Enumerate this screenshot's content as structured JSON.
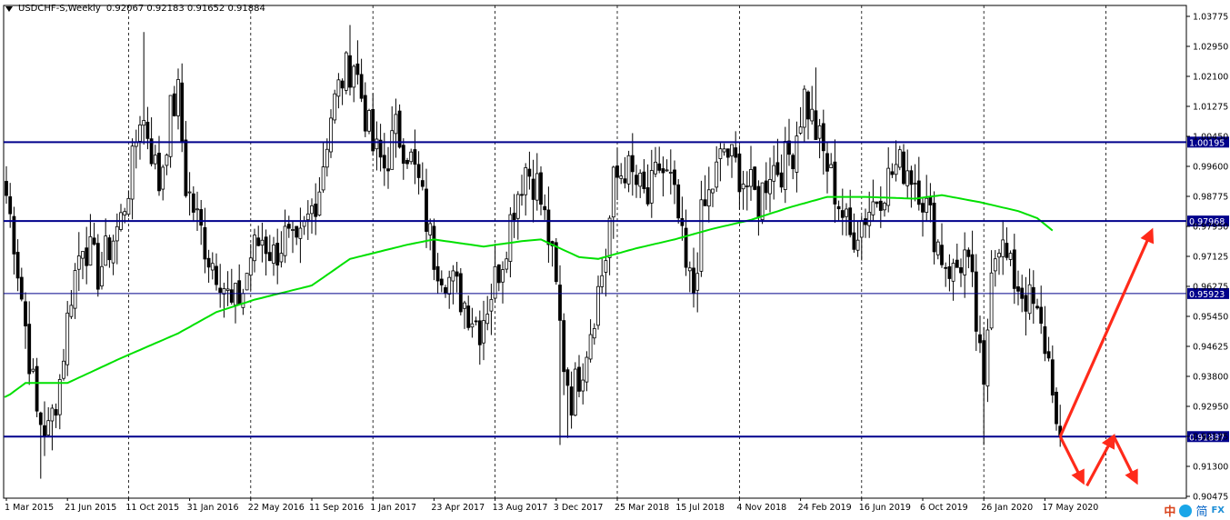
{
  "header": {
    "symbol": "USDCHF-S,Weekly",
    "ohlc": "0.92067 0.92183 0.91652 0.91884"
  },
  "brand": {
    "char1": "中",
    "char2": "简",
    "logo_text": "FX"
  },
  "colors": {
    "candle": "#000000",
    "ma": "#00e000",
    "level": "#00008b",
    "arrow": "#ff2a1a",
    "grid": "#000000",
    "axis_text": "#000000"
  },
  "chart_data": {
    "type": "candlestick",
    "timeframe": "Weekly",
    "ylim": [
      0.9015,
      1.0405
    ],
    "y_ticks": [
      "1.03775",
      "1.02950",
      "1.02100",
      "1.01275",
      "1.00450",
      "0.99600",
      "0.98775",
      "0.97950",
      "0.97125",
      "0.96275",
      "0.95450",
      "0.94625",
      "0.93800",
      "0.92950",
      "0.92125",
      "0.91300",
      "0.90475"
    ],
    "x_ticks": [
      "1 Mar 2015",
      "21 Jun 2015",
      "11 Oct 2015",
      "31 Jan 2016",
      "22 May 2016",
      "11 Sep 2016",
      "1 Jan 2017",
      "23 Apr 2017",
      "13 Aug 2017",
      "3 Dec 2017",
      "25 Mar 2018",
      "15 Jul 2018",
      "4 Nov 2018",
      "24 Feb 2019",
      "16 Jun 2019",
      "6 Oct 2019",
      "26 Jan 2020",
      "17 May 2020"
    ],
    "x_ticks_weeks": [
      0,
      16,
      32,
      48,
      64,
      80,
      96,
      112,
      128,
      144,
      160,
      176,
      192,
      208,
      224,
      240,
      256,
      272
    ],
    "grid_weeks": [
      32,
      64,
      96,
      128,
      160,
      192,
      224,
      256,
      288
    ],
    "total_weeks": 297,
    "price_levels": [
      {
        "label": "1.00195",
        "value": 1.00195,
        "weight": "thick"
      },
      {
        "label": "0.97968",
        "value": 0.97968,
        "weight": "thick"
      },
      {
        "label": "0.95923",
        "value": 0.95923,
        "weight": "thin"
      },
      {
        "label": "0.91887",
        "value": 0.91887,
        "weight": "thick"
      }
    ],
    "close_anchors": [
      [
        0,
        0.987
      ],
      [
        2,
        0.975
      ],
      [
        5,
        0.95
      ],
      [
        8,
        0.925
      ],
      [
        11,
        0.92
      ],
      [
        14,
        0.935
      ],
      [
        17,
        0.96
      ],
      [
        20,
        0.975
      ],
      [
        24,
        0.965
      ],
      [
        28,
        0.975
      ],
      [
        30,
        0.98
      ],
      [
        33,
        0.995
      ],
      [
        35,
        1.01
      ],
      [
        37,
        1.005
      ],
      [
        40,
        0.99
      ],
      [
        43,
        1.01
      ],
      [
        45,
        1.015
      ],
      [
        47,
        0.99
      ],
      [
        50,
        0.98
      ],
      [
        53,
        0.97
      ],
      [
        56,
        0.965
      ],
      [
        59,
        0.955
      ],
      [
        62,
        0.96
      ],
      [
        64,
        0.97
      ],
      [
        67,
        0.975
      ],
      [
        70,
        0.97
      ],
      [
        73,
        0.975
      ],
      [
        76,
        0.97
      ],
      [
        79,
        0.98
      ],
      [
        82,
        0.99
      ],
      [
        85,
        1.01
      ],
      [
        88,
        1.02
      ],
      [
        91,
        1.025
      ],
      [
        93,
        1.015
      ],
      [
        96,
        1.0
      ],
      [
        99,
        0.995
      ],
      [
        102,
        1.005
      ],
      [
        105,
        1.0
      ],
      [
        108,
        0.99
      ],
      [
        110,
        0.98
      ],
      [
        112,
        0.97
      ],
      [
        115,
        0.965
      ],
      [
        118,
        0.96
      ],
      [
        121,
        0.955
      ],
      [
        124,
        0.95
      ],
      [
        127,
        0.96
      ],
      [
        130,
        0.97
      ],
      [
        133,
        0.985
      ],
      [
        136,
        0.995
      ],
      [
        139,
        0.99
      ],
      [
        142,
        0.975
      ],
      [
        144,
        0.96
      ],
      [
        146,
        0.94
      ],
      [
        148,
        0.93
      ],
      [
        151,
        0.94
      ],
      [
        154,
        0.955
      ],
      [
        157,
        0.97
      ],
      [
        159,
        0.99
      ],
      [
        162,
        0.995
      ],
      [
        165,
        0.99
      ],
      [
        168,
        0.985
      ],
      [
        171,
        0.995
      ],
      [
        174,
        0.99
      ],
      [
        176,
        0.98
      ],
      [
        178,
        0.965
      ],
      [
        180,
        0.96
      ],
      [
        182,
        0.98
      ],
      [
        185,
        0.99
      ],
      [
        188,
        1.0
      ],
      [
        191,
        0.995
      ],
      [
        194,
        0.99
      ],
      [
        197,
        0.985
      ],
      [
        200,
        0.995
      ],
      [
        203,
        0.995
      ],
      [
        206,
        1.0
      ],
      [
        209,
        1.015
      ],
      [
        212,
        1.005
      ],
      [
        215,
        0.995
      ],
      [
        218,
        0.985
      ],
      [
        221,
        0.975
      ],
      [
        224,
        0.98
      ],
      [
        227,
        0.985
      ],
      [
        230,
        0.99
      ],
      [
        233,
        0.995
      ],
      [
        236,
        0.995
      ],
      [
        239,
        0.99
      ],
      [
        242,
        0.98
      ],
      [
        245,
        0.97
      ],
      [
        248,
        0.965
      ],
      [
        251,
        0.97
      ],
      [
        253,
        0.96
      ],
      [
        255,
        0.94
      ],
      [
        256,
        0.93
      ],
      [
        258,
        0.97
      ],
      [
        260,
        0.975
      ],
      [
        263,
        0.965
      ],
      [
        266,
        0.96
      ],
      [
        269,
        0.955
      ],
      [
        272,
        0.945
      ],
      [
        274,
        0.935
      ],
      [
        275,
        0.92
      ],
      [
        276,
        0.91884
      ]
    ],
    "ma_anchors": [
      [
        0,
        0.93
      ],
      [
        5,
        0.934
      ],
      [
        16,
        0.934
      ],
      [
        30,
        0.941
      ],
      [
        45,
        0.948
      ],
      [
        55,
        0.954
      ],
      [
        65,
        0.9575
      ],
      [
        80,
        0.9615
      ],
      [
        90,
        0.969
      ],
      [
        105,
        0.973
      ],
      [
        112,
        0.9745
      ],
      [
        125,
        0.9725
      ],
      [
        135,
        0.974
      ],
      [
        140,
        0.9745
      ],
      [
        150,
        0.9695
      ],
      [
        155,
        0.969
      ],
      [
        165,
        0.972
      ],
      [
        175,
        0.9745
      ],
      [
        185,
        0.9775
      ],
      [
        195,
        0.98
      ],
      [
        205,
        0.9835
      ],
      [
        215,
        0.9865
      ],
      [
        225,
        0.9865
      ],
      [
        238,
        0.986
      ],
      [
        245,
        0.987
      ],
      [
        255,
        0.985
      ],
      [
        265,
        0.9825
      ],
      [
        270,
        0.9805
      ],
      [
        274,
        0.977
      ]
    ],
    "lows_marked": [
      [
        9,
        0.907
      ],
      [
        12,
        0.915
      ],
      [
        145,
        0.9165
      ],
      [
        147,
        0.9185
      ],
      [
        256,
        0.9165
      ],
      [
        276,
        0.916
      ]
    ],
    "highs_marked": [
      [
        36,
        1.033
      ],
      [
        90,
        1.035
      ],
      [
        212,
        1.023
      ]
    ],
    "forecast_arrows": [
      {
        "from": [
          276,
          0.91887
        ],
        "to": [
          300,
          0.977
        ]
      },
      {
        "from": [
          276,
          0.91887
        ],
        "to": [
          282,
          0.906
        ]
      },
      {
        "from": [
          283,
          0.905
        ],
        "to": [
          290,
          0.919
        ]
      },
      {
        "from": [
          290,
          0.919
        ],
        "to": [
          296,
          0.906
        ]
      }
    ]
  }
}
